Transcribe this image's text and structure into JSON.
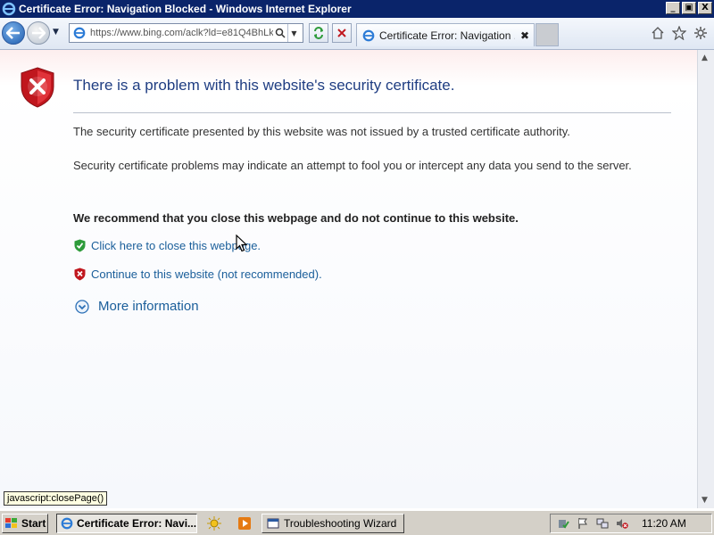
{
  "window": {
    "title": "Certificate Error: Navigation Blocked - Windows Internet Explorer",
    "controls": {
      "minimize": "_",
      "maximize": "▣",
      "close": "X"
    }
  },
  "toolbar": {
    "url": "https://www.bing.com/aclk?ld=e81Q4BhLk",
    "tab_label": "Certificate Error: Navigation ...",
    "tab_close": "✖"
  },
  "page": {
    "heading": "There is a problem with this website's security certificate.",
    "para1": "The security certificate presented by this website was not issued by a trusted certificate authority.",
    "para2": "Security certificate problems may indicate an attempt to fool you or intercept any data you send to the server.",
    "recommend": "We recommend that you close this webpage and do not continue to this website.",
    "link_close": "Click here to close this webpage.",
    "link_continue": "Continue to this website (not recommended).",
    "more_info": "More information"
  },
  "status_tooltip": "javascript:closePage()",
  "taskbar": {
    "start_label": "Start",
    "tasks": [
      {
        "label": "Certificate Error: Navi...",
        "active": true
      },
      {
        "label": "Troubleshooting Wizard",
        "active": false
      }
    ],
    "clock": "11:20 AM"
  },
  "colors": {
    "titlebar": "#0a246a",
    "heading": "#1f3d82",
    "link": "#1a5e9a",
    "error_red": "#c0171e",
    "safe_green": "#2e9b3a"
  }
}
